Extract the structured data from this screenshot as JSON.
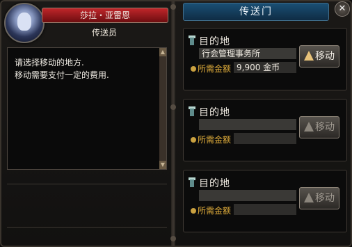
{
  "npc": {
    "name": "莎拉・亚雷恩",
    "role": "传送员",
    "dialog_lines": [
      "请选择移动的地方.",
      "移动需要支付一定的费用."
    ]
  },
  "teleport": {
    "title": "传送门",
    "close_icon": "close-icon",
    "slots": [
      {
        "dest_label": "目的地",
        "destination": "行会管理事务所",
        "cost_label": "所需金额",
        "cost": "9,900 金币",
        "move_label": "移动",
        "enabled": true
      },
      {
        "dest_label": "目的地",
        "destination": "",
        "cost_label": "所需金额",
        "cost": "",
        "move_label": "移动",
        "enabled": false
      },
      {
        "dest_label": "目的地",
        "destination": "",
        "cost_label": "所需金额",
        "cost": "",
        "move_label": "移动",
        "enabled": false
      }
    ]
  },
  "colors": {
    "name_bar": "#c0262a",
    "title_bar": "#1a4f74",
    "cost_label": "#e4b03c",
    "move_arrow": "#e7c27a"
  }
}
